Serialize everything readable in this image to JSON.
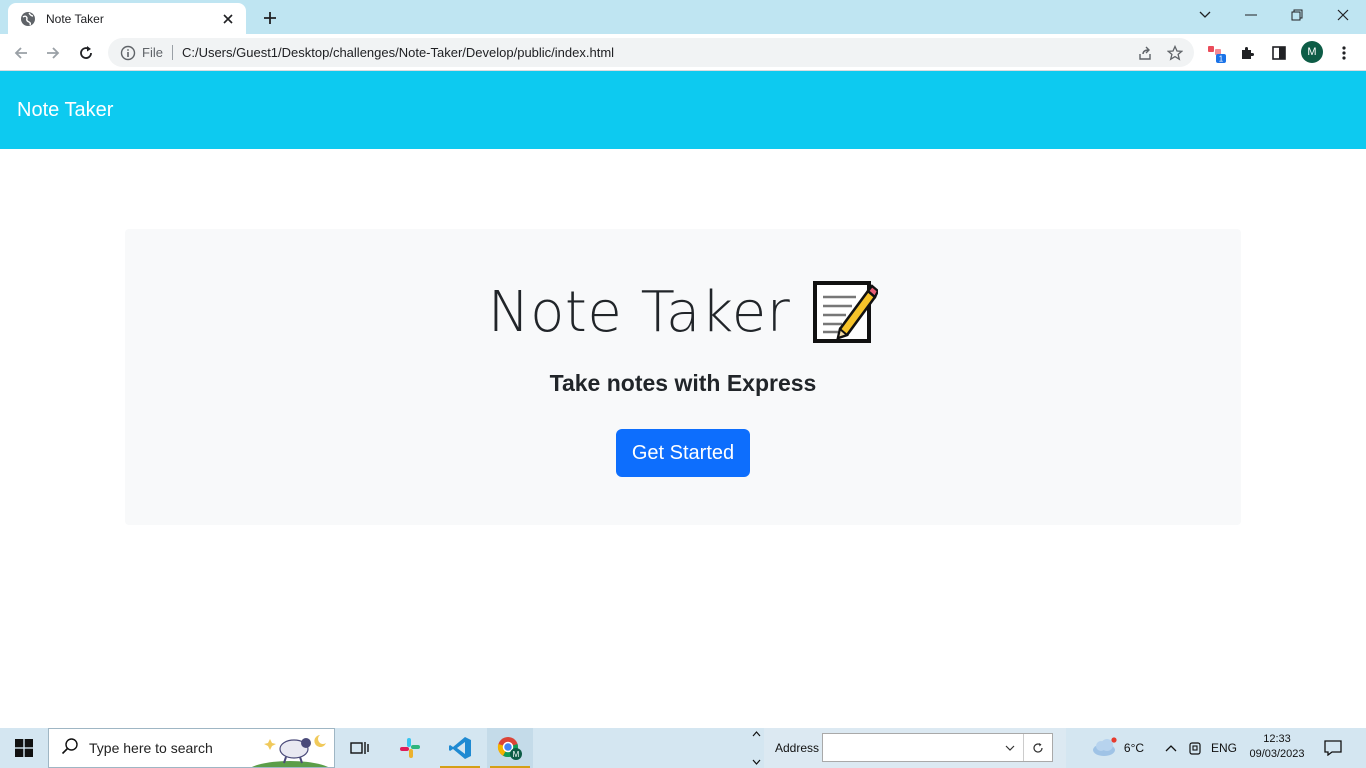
{
  "browser": {
    "tab_title": "Note Taker",
    "address_scheme": "File",
    "address_url": "C:/Users/Guest1/Desktop/challenges/Note-Taker/Develop/public/index.html",
    "extension_badge": "1",
    "profile_initial": "M"
  },
  "navbar": {
    "brand": "Note Taker"
  },
  "hero": {
    "title": "Note Taker",
    "subtitle": "Take notes with Express",
    "button_label": "Get Started"
  },
  "taskbar": {
    "search_placeholder": "Type here to search",
    "address_label": "Address",
    "weather_temp": "6°C",
    "language": "ENG",
    "time": "12:33",
    "date": "09/03/2023",
    "chrome_profile_initial": "M"
  },
  "colors": {
    "navbar_bg": "#0dcaf0",
    "primary_button": "#0d6efd",
    "hero_bg": "#f8f9fa",
    "tabstrip_bg": "#bfe5f2"
  }
}
